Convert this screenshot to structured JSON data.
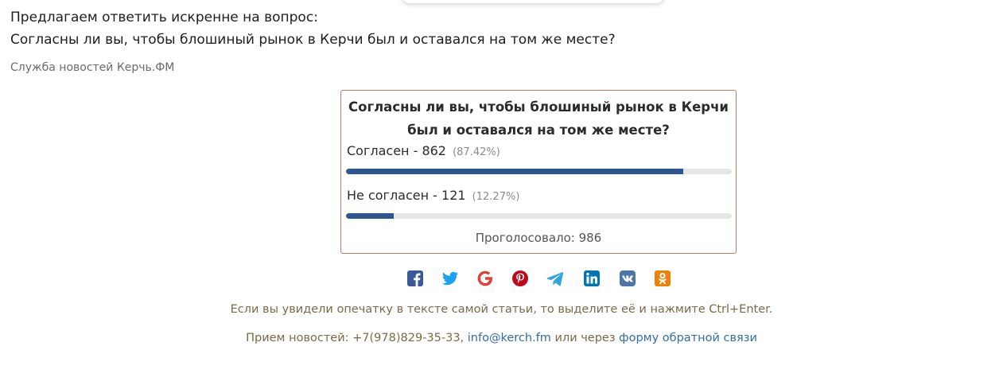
{
  "intro": {
    "line1": "Предлагаем ответить искренне на вопрос:",
    "line2": "Согласны ли вы, чтобы блошиный рынок в Керчи был и оставался на том же месте?"
  },
  "source": "Служба новостей Керчь.ФМ",
  "poll": {
    "question_line1": "Согласны ли вы, чтобы блошиный рынок в Керчи",
    "question_line2": "был и оставался на том же месте?",
    "options": [
      {
        "label": "Согласен - 862",
        "percent_text": "(87.42%)",
        "percent": 87.42
      },
      {
        "label": "Не согласен - 121",
        "percent_text": "(12.27%)",
        "percent": 12.27
      }
    ],
    "total": "Проголосовало: 986",
    "bar_color": "#2d5592",
    "border_color": "#c9795c"
  },
  "share": [
    {
      "name": "facebook-icon",
      "color": "#3b5998"
    },
    {
      "name": "twitter-icon",
      "color": "#1da1f2"
    },
    {
      "name": "google-icon",
      "color": "#db4437"
    },
    {
      "name": "pinterest-icon",
      "color": "#bd081c"
    },
    {
      "name": "telegram-icon",
      "color": "#2ca5e0"
    },
    {
      "name": "linkedin-icon",
      "color": "#0077b5"
    },
    {
      "name": "vk-icon",
      "color": "#4a76a8"
    },
    {
      "name": "odnoklassniki-icon",
      "color": "#ee8208"
    }
  ],
  "footer": {
    "note": "Если вы увидели опечатку в тексте самой статьи, то выделите её и нажмите Ctrl+Enter.",
    "contacts_prefix": "Прием новостей: +7(978)829-35-33, ",
    "email": "info@kerch.fm",
    "contacts_middle": " или через ",
    "feedback_link": "форму обратной связи"
  }
}
